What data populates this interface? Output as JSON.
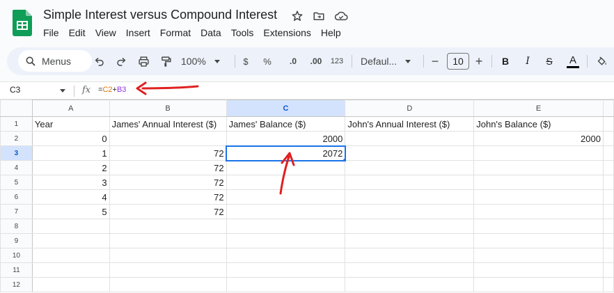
{
  "doc": {
    "title": "Simple Interest versus Compound Interest"
  },
  "menu": [
    "File",
    "Edit",
    "View",
    "Insert",
    "Format",
    "Data",
    "Tools",
    "Extensions",
    "Help"
  ],
  "toolbar": {
    "menus_label": "Menus",
    "zoom": "100%",
    "currency": "$",
    "percent": "%",
    "dec_decrease": ".0",
    "dec_increase": ".00",
    "number_format": "123",
    "font": "Defaul...",
    "font_size": "10",
    "minus": "−",
    "plus": "+",
    "bold": "B",
    "italic": "I",
    "strike": "S",
    "text_color": "A"
  },
  "formula_bar": {
    "cell_ref": "C3",
    "fx": "fx",
    "formula_prefix": "=",
    "ref1": "C2",
    "op": "+",
    "ref2": "B3"
  },
  "columns": [
    "A",
    "B",
    "C",
    "D",
    "E"
  ],
  "rows": [
    {
      "n": "1",
      "cells": [
        "Year",
        "James' Annual Interest ($)",
        "James' Balance ($)",
        "John's Annual Interest ($)",
        "John's Balance ($)"
      ]
    },
    {
      "n": "2",
      "cells": [
        "0",
        "",
        "2000",
        "",
        "2000"
      ]
    },
    {
      "n": "3",
      "cells": [
        "1",
        "72",
        "2072",
        "",
        ""
      ]
    },
    {
      "n": "4",
      "cells": [
        "2",
        "72",
        "",
        "",
        ""
      ]
    },
    {
      "n": "5",
      "cells": [
        "3",
        "72",
        "",
        "",
        ""
      ]
    },
    {
      "n": "6",
      "cells": [
        "4",
        "72",
        "",
        "",
        ""
      ]
    },
    {
      "n": "7",
      "cells": [
        "5",
        "72",
        "",
        "",
        ""
      ]
    },
    {
      "n": "8",
      "cells": [
        "",
        "",
        "",
        "",
        ""
      ]
    },
    {
      "n": "9",
      "cells": [
        "",
        "",
        "",
        "",
        ""
      ]
    },
    {
      "n": "10",
      "cells": [
        "",
        "",
        "",
        "",
        ""
      ]
    },
    {
      "n": "11",
      "cells": [
        "",
        "",
        "",
        "",
        ""
      ]
    },
    {
      "n": "12",
      "cells": [
        "",
        "",
        "",
        "",
        ""
      ]
    }
  ],
  "selection": {
    "col": "C",
    "row": "3"
  },
  "colors": {
    "accent": "#1a73e8",
    "annotation": "#e02020",
    "header_selected": "#d3e3fd",
    "sheets_green": "#0f9d58"
  }
}
